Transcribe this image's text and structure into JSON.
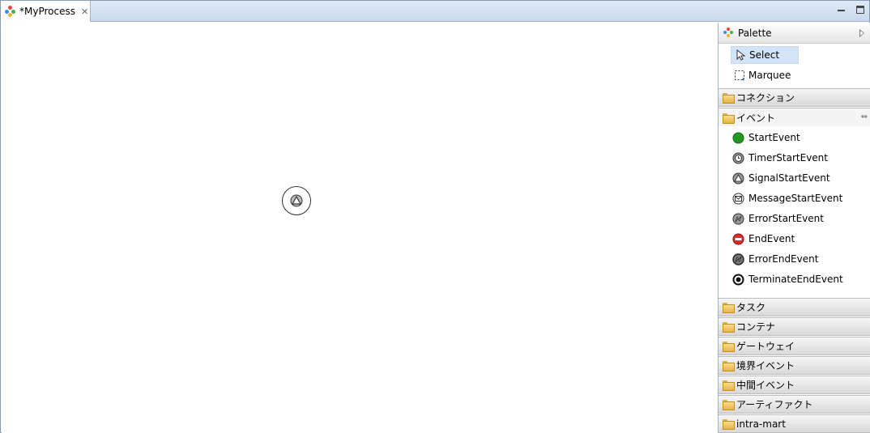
{
  "editor": {
    "tab_title": "*MyProcess",
    "close_glyph": "✕"
  },
  "palette": {
    "title": "Palette",
    "tools": [
      {
        "label": "Select",
        "icon": "arrow-pointer-icon"
      },
      {
        "label": "Marquee",
        "icon": "marquee-icon"
      }
    ],
    "drawers": [
      {
        "label": "コネクション"
      },
      {
        "label": "イベント"
      },
      {
        "label": "タスク"
      },
      {
        "label": "コンテナ"
      },
      {
        "label": "ゲートウェイ"
      },
      {
        "label": "境界イベント"
      },
      {
        "label": "中間イベント"
      },
      {
        "label": "アーティファクト"
      },
      {
        "label": "intra-mart"
      }
    ],
    "events": [
      {
        "label": "StartEvent",
        "icon": "start-event-icon"
      },
      {
        "label": "TimerStartEvent",
        "icon": "timer-start-event-icon"
      },
      {
        "label": "SignalStartEvent",
        "icon": "signal-start-event-icon"
      },
      {
        "label": "MessageStartEvent",
        "icon": "message-start-event-icon"
      },
      {
        "label": "ErrorStartEvent",
        "icon": "error-start-event-icon"
      },
      {
        "label": "EndEvent",
        "icon": "end-event-icon"
      },
      {
        "label": "ErrorEndEvent",
        "icon": "error-end-event-icon"
      },
      {
        "label": "TerminateEndEvent",
        "icon": "terminate-end-event-icon"
      }
    ]
  },
  "colors": {
    "start_green": "#1f9a1f",
    "end_red": "#d33030",
    "selection": "#d3e3f8"
  }
}
